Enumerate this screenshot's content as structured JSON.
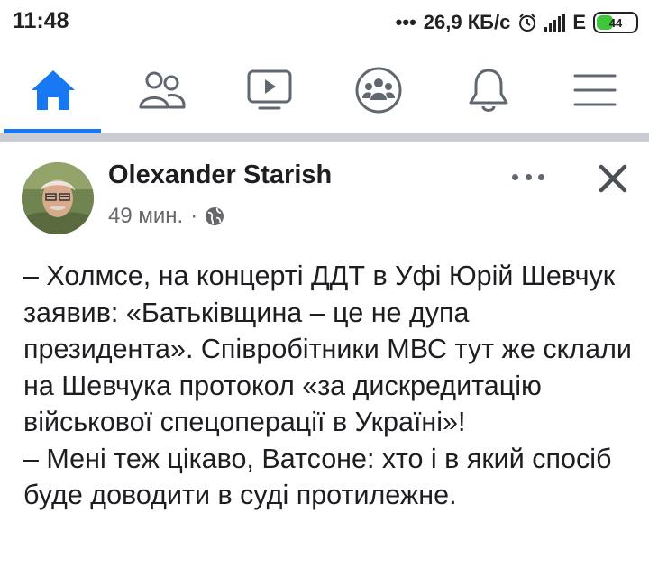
{
  "status_bar": {
    "time": "11:48",
    "network_speed": "26,9 КБ/с",
    "network_type": "E",
    "battery_level": "44",
    "icons": [
      "alarm-icon",
      "signal-icon",
      "battery-icon"
    ]
  },
  "nav": {
    "tabs": [
      {
        "name": "home",
        "icon": "home-icon",
        "active": true
      },
      {
        "name": "friends",
        "icon": "friends-icon",
        "active": false
      },
      {
        "name": "watch",
        "icon": "video-icon",
        "active": false
      },
      {
        "name": "groups",
        "icon": "groups-icon",
        "active": false
      },
      {
        "name": "notifications",
        "icon": "bell-icon",
        "active": false
      },
      {
        "name": "menu",
        "icon": "hamburger-icon",
        "active": false
      }
    ]
  },
  "colors": {
    "accent": "#1877f2",
    "icon_gray": "#606770",
    "meta_gray": "#65676b",
    "separator": "#c9ccd1"
  },
  "post": {
    "author": "Olexander Starish",
    "time": "49 мин.",
    "separator_dot": "·",
    "audience_icon": "globe-icon",
    "paragraphs": [
      "– Холмсе, на концерті ДДТ в Уфі Юрій Шевчук заявив: «Батьківщина – це не дупа президента». Співробітники МВС тут же склали на Шевчука протокол «за дискредитацію військової спецоперації в Україні»!",
      "– Мені теж цікаво, Ватсоне: хто і в який спосіб буде доводити в суді протилежне."
    ]
  }
}
